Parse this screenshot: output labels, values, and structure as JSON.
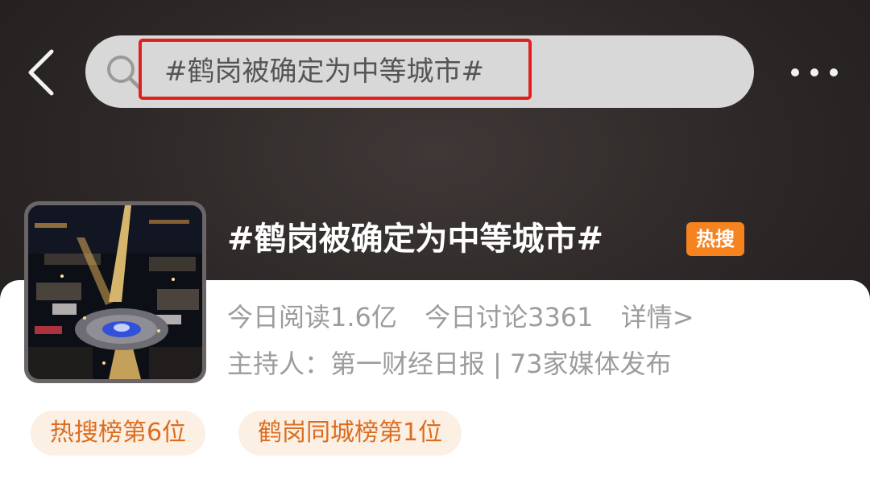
{
  "header": {
    "back_icon": "chevron-left-icon",
    "search": {
      "icon": "search-icon",
      "query": "#鹤岗被确定为中等城市#",
      "highlight_color": "#e02020"
    },
    "more_icon": "more-horizontal-icon"
  },
  "topic": {
    "cover": "night-city-aerial-photo",
    "title": "#鹤岗被确定为中等城市#",
    "hot_badge": "热搜",
    "hot_badge_color": "#f5831f",
    "stats": {
      "reads": "今日阅读1.6亿",
      "discussions": "今日讨论3361",
      "details_link": "详情>"
    },
    "host": {
      "label": "主持人：",
      "name": "第一财经日报",
      "separator": "|",
      "media": "73家媒体发布"
    },
    "rank_chips": [
      {
        "label": "热搜榜第6位"
      },
      {
        "label": "鹤岗同城榜第1位"
      }
    ],
    "chip_text_color": "#dc6d1f",
    "chip_bg_color": "#fcefe4"
  }
}
